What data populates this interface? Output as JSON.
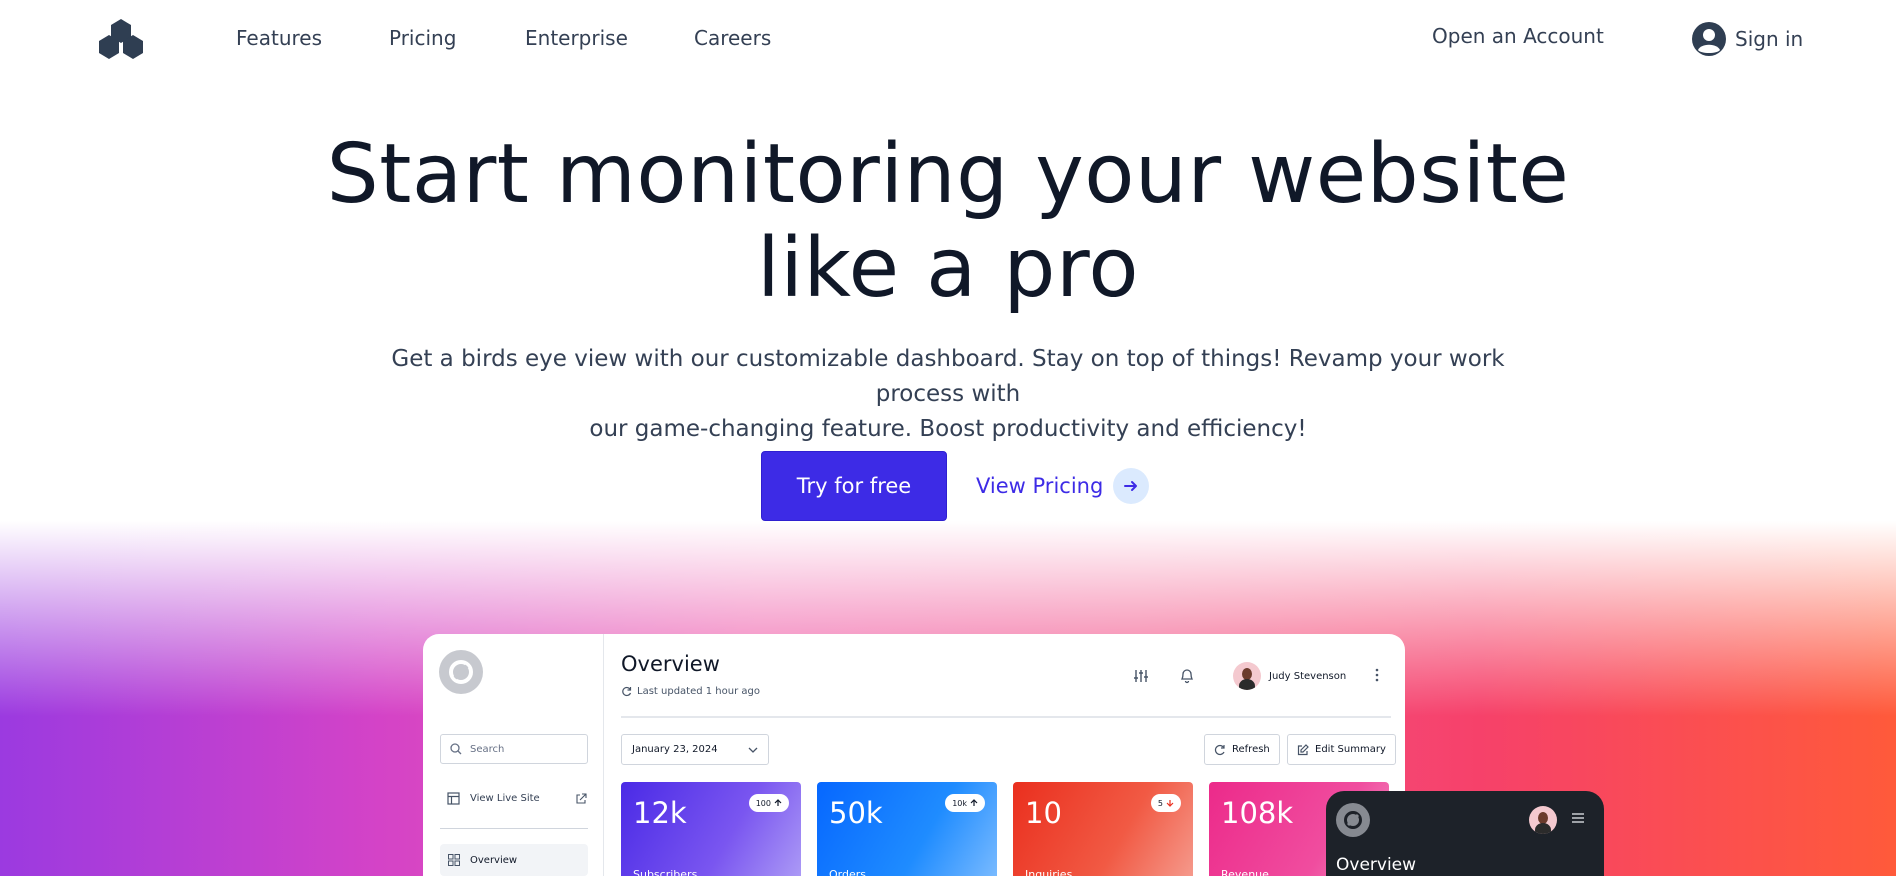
{
  "nav": {
    "links": [
      "Features",
      "Pricing",
      "Enterprise",
      "Careers"
    ],
    "open_account": "Open an Account",
    "sign_in": "Sign in"
  },
  "hero": {
    "title_line1": "Start monitoring your website",
    "title_line2": "like a pro",
    "subtitle_line1": "Get a birds eye view with our customizable dashboard. Stay on top of things! Revamp your work process with",
    "subtitle_line2": "our game-changing feature. Boost productivity and efficiency!",
    "cta": "Try for free",
    "secondary": "View Pricing"
  },
  "dashboard": {
    "search_placeholder": "Search",
    "view_live_site": "View Live Site",
    "overview_nav": "Overview",
    "title": "Overview",
    "last_updated": "Last updated 1 hour ago",
    "user_name": "Judy Stevenson",
    "date": "January 23, 2024",
    "refresh": "Refresh",
    "edit_summary": "Edit Summary",
    "stats": [
      {
        "value": "12k",
        "badge": "100",
        "trend": "up",
        "label": "Subscribers"
      },
      {
        "value": "50k",
        "badge": "10k",
        "trend": "up",
        "label": "Orders"
      },
      {
        "value": "10",
        "badge": "5",
        "trend": "down",
        "label": "Inquiries"
      },
      {
        "value": "108k",
        "badge": "",
        "trend": "",
        "label": "Revenue"
      }
    ]
  },
  "mobile": {
    "title": "Overview"
  },
  "colors": {
    "primary": "#3d2be6",
    "text_dark": "#101828",
    "stat1": "#5b2ee8",
    "stat2": "#0a7cff",
    "stat3": "#ee3b28",
    "stat4": "#ee2c8e",
    "mobile_bg": "#1d2229"
  }
}
